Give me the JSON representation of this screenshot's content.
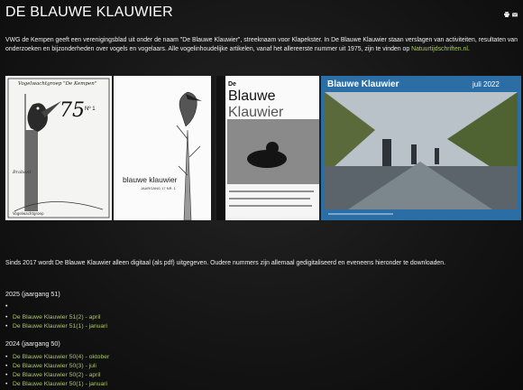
{
  "site": {
    "title": "DE BLAUWE KLAUWIER"
  },
  "toolbar": {
    "icons": [
      "print-icon",
      "email-icon"
    ]
  },
  "intro": {
    "text": "VWG de Kempen geeft een verenigingsblad uit onder de naam \"De Blauwe Klauwier\", streeknaam voor Klapekster. In De Blauwe Klauwier staan verslagen van activiteiten, resultaten van onderzoeken en bijzonderheden over vogels en vogelaars. Alle vogelinhoudelijke artikelen, vanaf het allereerste nummer uit 1975, zijn te vinden op ",
    "link": "Natuurtijdschriften.nl",
    "end": "."
  },
  "covers": {
    "c1_title": "Vogelwachtgroep \"De Kempen\"",
    "c1_number": "75",
    "c1_issue": "Nº 1",
    "c2_title": "blauwe klauwier",
    "c2_sub": "JAARGANG 17 NR. 1",
    "c3_title_line1": "De",
    "c3_title_line2": "Blauwe",
    "c3_title_line3": "Klauwier",
    "c4_title": "Blauwe Klauwier",
    "c4_date": "juli 2022"
  },
  "digital_note": "Sinds 2017 wordt De Blauwe Klauwier alleen digitaal (als pdf) uitgegeven. Oudere nummers zijn allemaal gedigitaliseerd en eveneens hieronder te downloaden.",
  "years": [
    {
      "heading": "2025 (jaargang 51)",
      "issues": [
        "De Blauwe Klauwier 51(2) - april",
        "De Blauwe Klauwier 51(1) - januari"
      ]
    },
    {
      "heading": "2024 (jaargang 50)",
      "issues": [
        "De Blauwe Klauwier 50(4) - oktober",
        "De Blauwe Klauwier 50(3) - juli",
        "De Blauwe Klauwier 50(2) - april",
        "De Blauwe Klauwier 50(1) - januari"
      ]
    }
  ],
  "colors": {
    "link": "#a7c95f",
    "background": "#141414",
    "cover_blue": "#2b6ea6"
  }
}
